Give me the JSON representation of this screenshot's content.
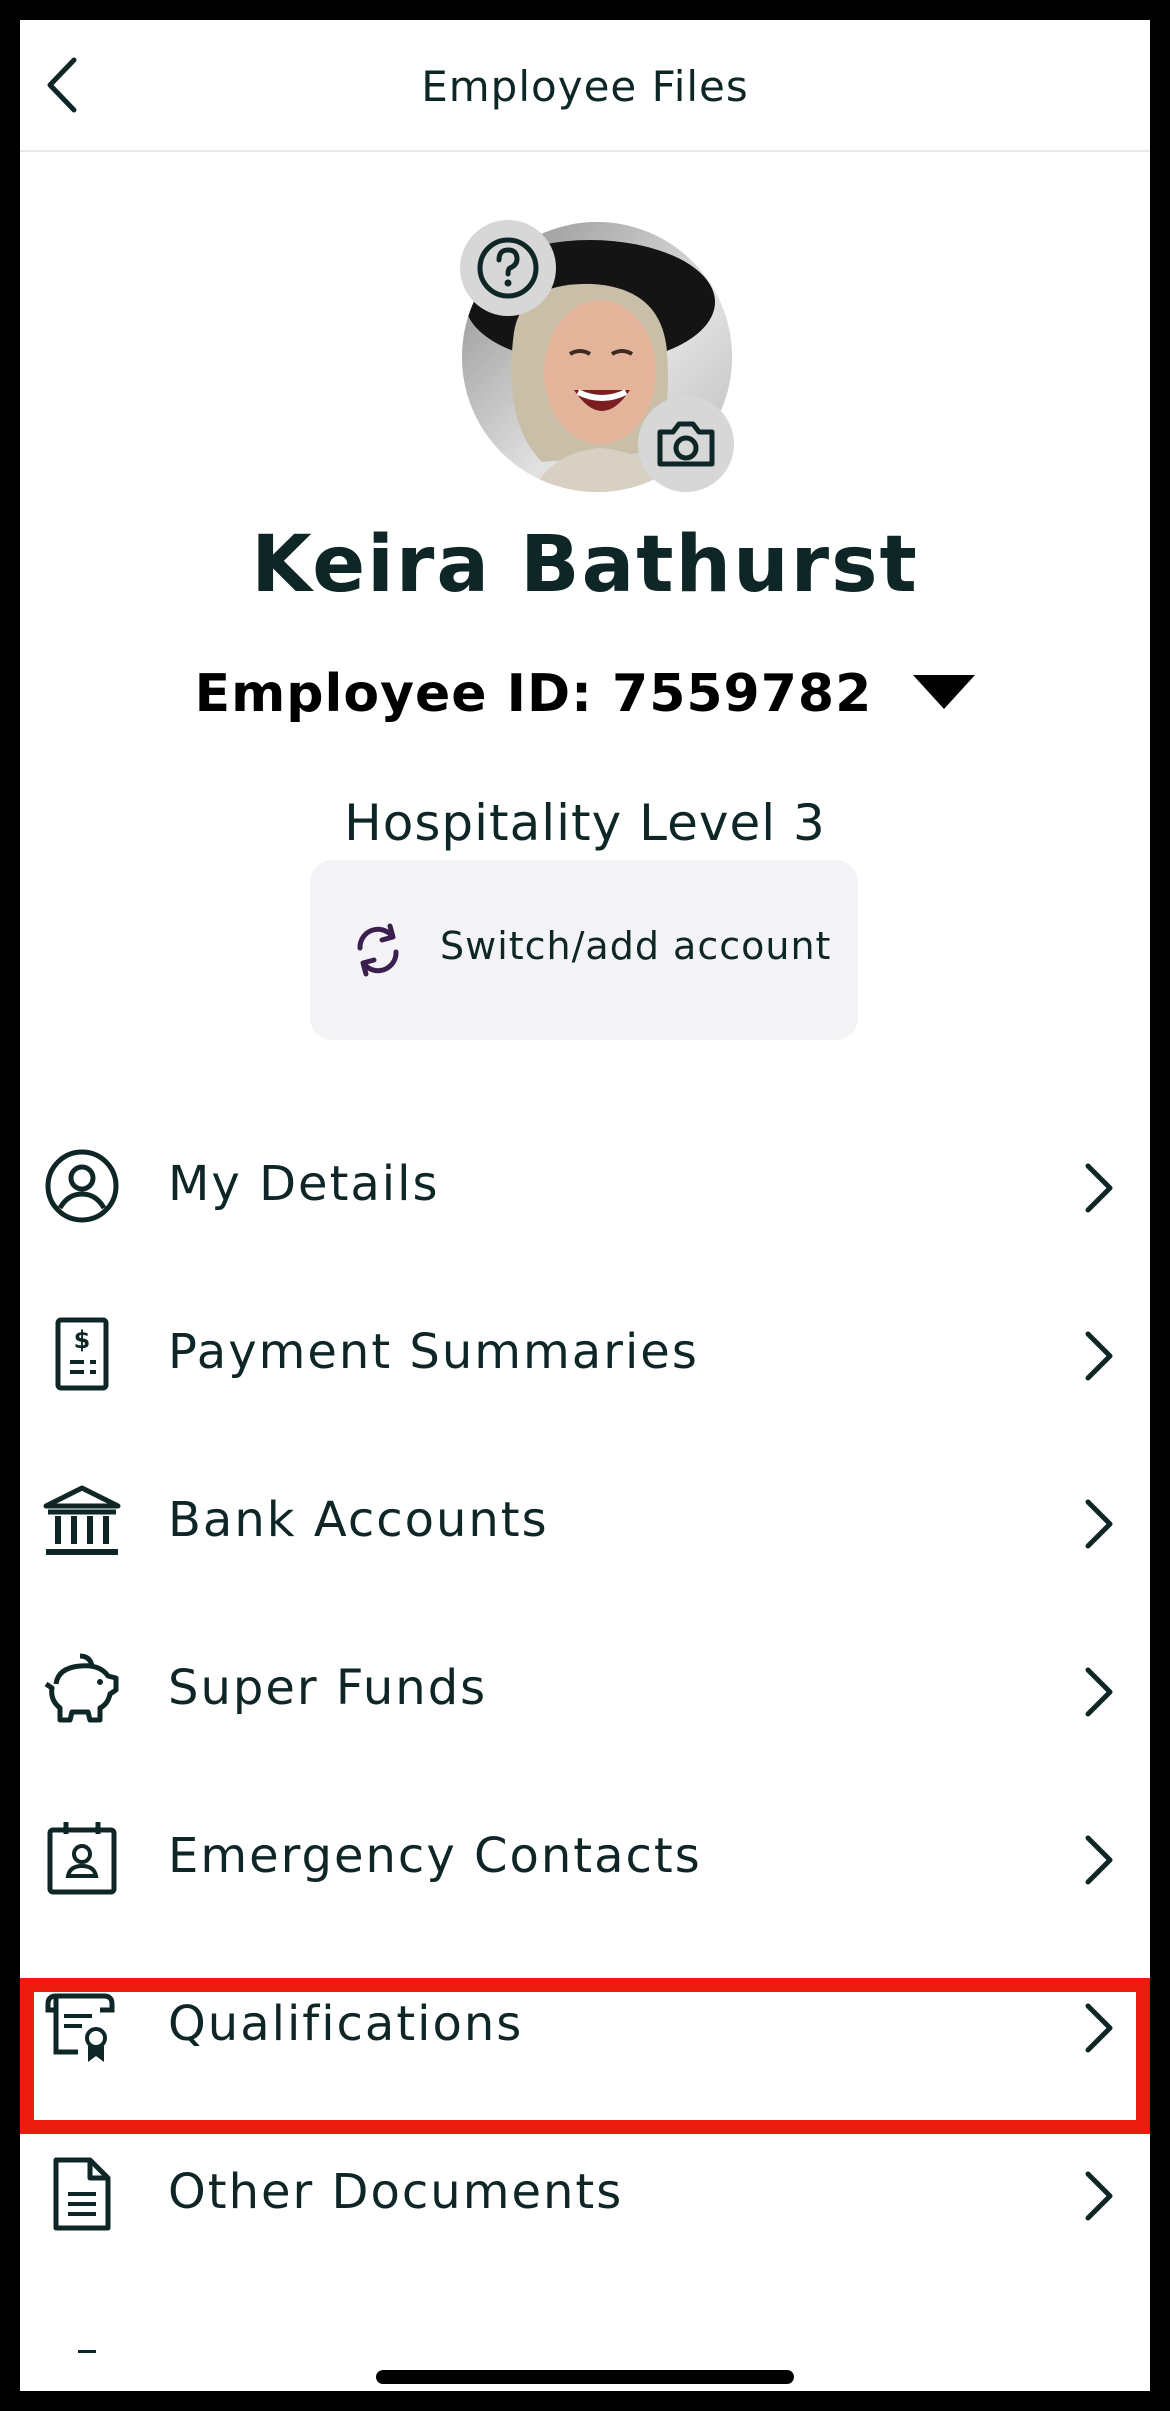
{
  "header": {
    "title": "Employee Files",
    "back_icon": "chevron-left-icon"
  },
  "profile": {
    "name": "Keira Bathurst",
    "employee_id": "Employee ID: 7559782",
    "level": "Hospitality Level 3",
    "help_icon": "question-circle-icon",
    "camera_icon": "camera-icon",
    "dropdown_icon": "caret-down-icon"
  },
  "switch_account": {
    "label": "Switch/add account",
    "icon": "refresh-icon",
    "icon_color": "#3b1f4f"
  },
  "menu": {
    "items": [
      {
        "label": "My Details",
        "icon": "user-circle-icon"
      },
      {
        "label": "Payment Summaries",
        "icon": "receipt-dollar-icon"
      },
      {
        "label": "Bank Accounts",
        "icon": "bank-icon"
      },
      {
        "label": "Super Funds",
        "icon": "piggy-bank-icon"
      },
      {
        "label": "Emergency Contacts",
        "icon": "contact-card-icon"
      },
      {
        "label": "Qualifications",
        "icon": "certificate-icon",
        "highlighted": true
      },
      {
        "label": "Other Documents",
        "icon": "document-icon"
      }
    ]
  },
  "colors": {
    "text": "#0f2626",
    "highlight_border": "#ee1b0f",
    "button_bg": "#f4f4f6"
  }
}
